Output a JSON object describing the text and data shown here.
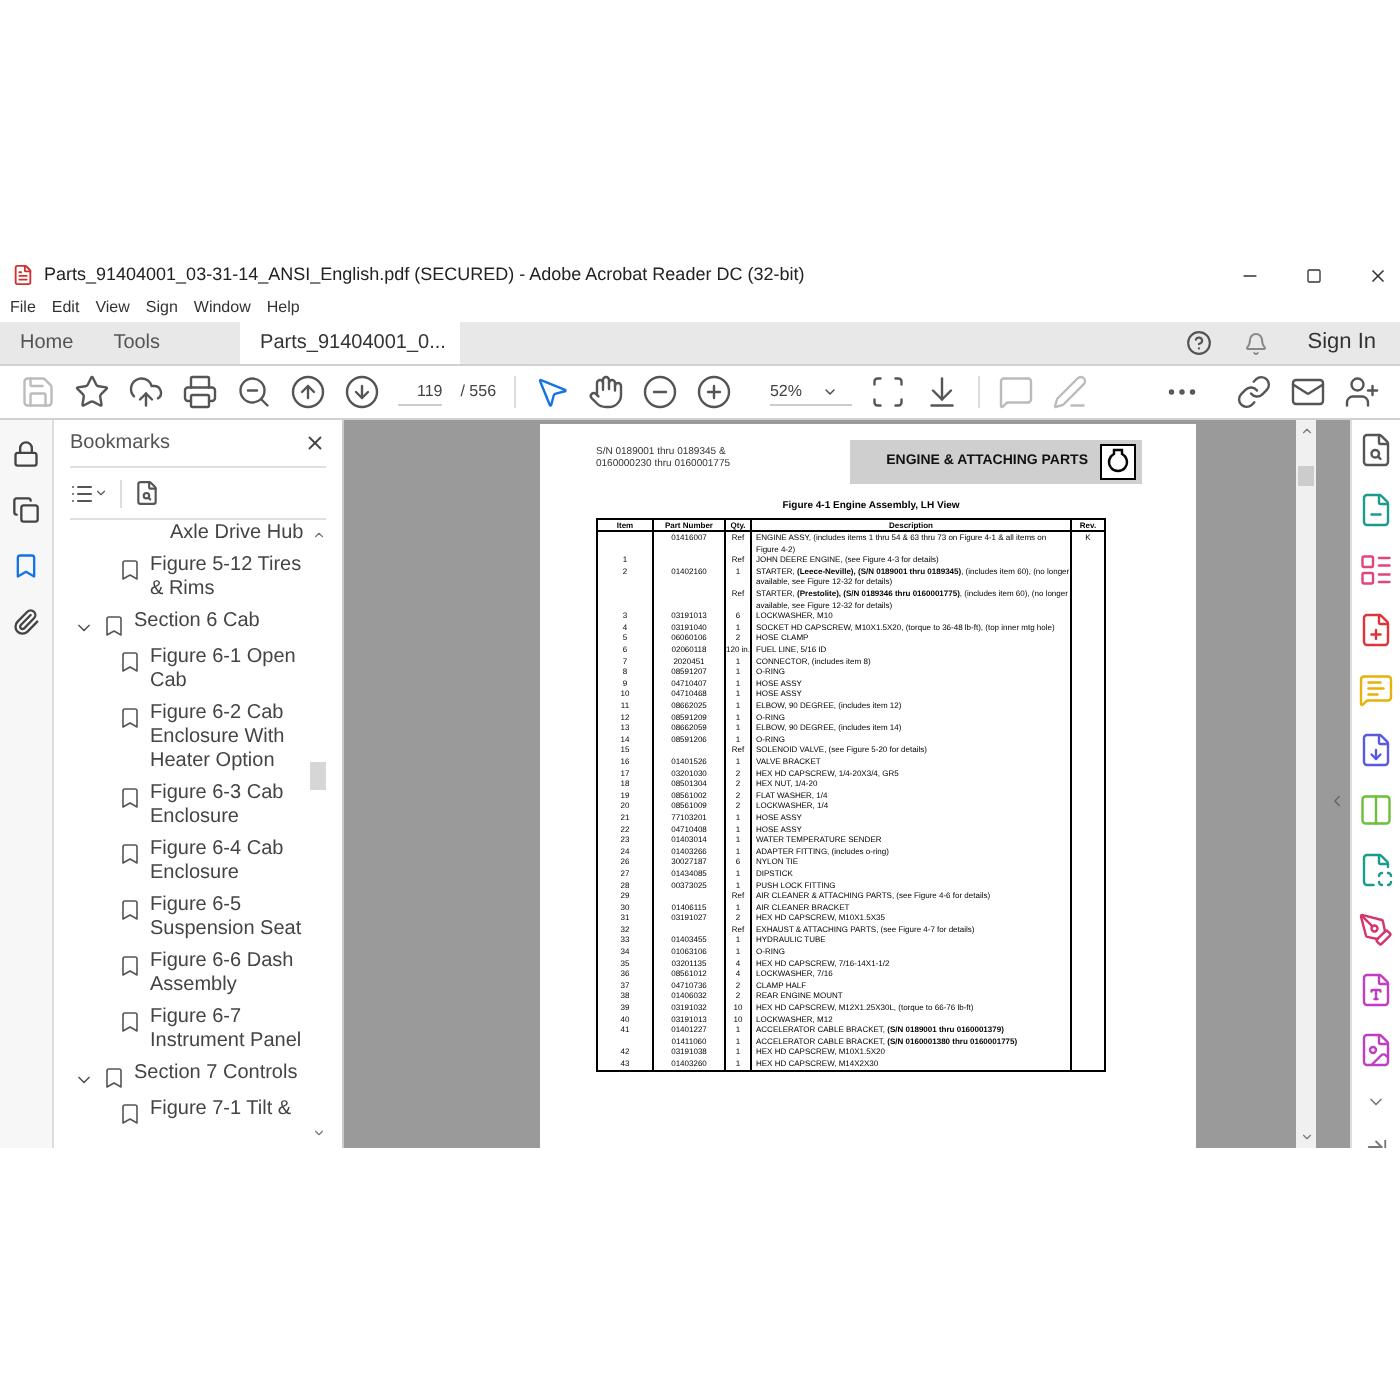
{
  "window": {
    "title": "Parts_91404001_03-31-14_ANSI_English.pdf (SECURED) - Adobe Acrobat Reader DC (32-bit)"
  },
  "menu": [
    "File",
    "Edit",
    "View",
    "Sign",
    "Window",
    "Help"
  ],
  "tabs": [
    {
      "label": "Home",
      "selected": false
    },
    {
      "label": "Tools",
      "selected": false
    },
    {
      "label": "Parts_91404001_0...",
      "selected": true
    }
  ],
  "sign_in": "Sign In",
  "toolbar": {
    "page": "119",
    "page_count": "/ 556",
    "zoom": "52%"
  },
  "bookmarks": {
    "title": "Bookmarks",
    "continued": [
      {
        "label": "Axle Drive Hub"
      },
      {
        "label": "Figure 5-12 Tires & Rims"
      }
    ],
    "sections": [
      {
        "label": "Section 6 Cab",
        "expanded": true,
        "children": [
          {
            "label": "Figure 6-1 Open Cab"
          },
          {
            "label": "Figure 6-2 Cab Enclosure With Heater Option"
          },
          {
            "label": "Figure 6-3 Cab Enclosure"
          },
          {
            "label": "Figure 6-4 Cab Enclosure"
          },
          {
            "label": "Figure 6-5 Suspension Seat"
          },
          {
            "label": "Figure 6-6 Dash Assembly"
          },
          {
            "label": "Figure 6-7 Instrument Panel"
          }
        ]
      },
      {
        "label": "Section 7 Controls",
        "expanded": true,
        "children": [
          {
            "label": "Figure 7-1 Tilt &"
          }
        ]
      }
    ]
  },
  "document": {
    "serial_lines": [
      "S/N 0189001 thru 0189345 &",
      "0160000230 thru 0160001775"
    ],
    "section_title": "ENGINE & ATTACHING PARTS",
    "figure_title": "Figure 4-1 Engine Assembly, LH View",
    "columns": [
      "Item",
      "Part Number",
      "Qty.",
      "Description",
      "Rev."
    ],
    "rows": [
      [
        "",
        "01416007",
        "Ref",
        "ENGINE ASSY, (includes items 1 thru 54 & 63 thru 73 on Figure 4-1 & all items on Figure 4-2)",
        "K"
      ],
      [
        "1",
        "",
        "Ref",
        "JOHN DEERE ENGINE, (see Figure 4-3 for details)",
        ""
      ],
      [
        "2",
        "01402160",
        "1",
        "STARTER, **(Leece-Neville), (S/N 0189001 thru 0189345)**, (includes item 60), (no longer available, see Figure 12-32 for details)",
        ""
      ],
      [
        "",
        "",
        "Ref",
        "STARTER, **(Prestolite), (S/N 0189346 thru 0160001775)**, (includes item 60), (no longer available, see Figure 12-32 for details)",
        ""
      ],
      [
        "3",
        "03191013",
        "6",
        "LOCKWASHER, M10",
        ""
      ],
      [
        "4",
        "03191040",
        "1",
        "SOCKET HD CAPSCREW, M10X1.5X20, (torque to 36-48 lb-ft), (top inner mtg hole)",
        ""
      ],
      [
        "5",
        "06060106",
        "2",
        "HOSE CLAMP",
        ""
      ],
      [
        "6",
        "02060118",
        "120 in.",
        "FUEL LINE, 5/16 ID",
        ""
      ],
      [
        "7",
        "2020451",
        "1",
        "CONNECTOR, (includes item 8)",
        ""
      ],
      [
        "8",
        "08591207",
        "1",
        "O-RING",
        ""
      ],
      [
        "9",
        "04710407",
        "1",
        "HOSE ASSY",
        ""
      ],
      [
        "10",
        "04710468",
        "1",
        "HOSE ASSY",
        ""
      ],
      [
        "11",
        "08662025",
        "1",
        "ELBOW, 90 DEGREE, (includes item 12)",
        ""
      ],
      [
        "12",
        "08591209",
        "1",
        "O-RING",
        ""
      ],
      [
        "13",
        "08662059",
        "1",
        "ELBOW, 90 DEGREE, (includes item 14)",
        ""
      ],
      [
        "14",
        "08591206",
        "1",
        "O-RING",
        ""
      ],
      [
        "15",
        "",
        "Ref",
        "SOLENOID VALVE, (see Figure 5-20 for details)",
        ""
      ],
      [
        "16",
        "01401526",
        "1",
        "VALVE BRACKET",
        ""
      ],
      [
        "17",
        "03201030",
        "2",
        "HEX HD CAPSCREW, 1/4-20X3/4, GR5",
        ""
      ],
      [
        "18",
        "08501304",
        "2",
        "HEX NUT, 1/4-20",
        ""
      ],
      [
        "19",
        "08561002",
        "2",
        "FLAT WASHER, 1/4",
        ""
      ],
      [
        "20",
        "08561009",
        "2",
        "LOCKWASHER, 1/4",
        ""
      ],
      [
        "21",
        "77103201",
        "1",
        "HOSE ASSY",
        ""
      ],
      [
        "22",
        "04710408",
        "1",
        "HOSE ASSY",
        ""
      ],
      [
        "23",
        "01403014",
        "1",
        "WATER TEMPERATURE SENDER",
        ""
      ],
      [
        "24",
        "01403266",
        "1",
        "ADAPTER FITTING, (includes o-ring)",
        ""
      ],
      [
        "26",
        "30027187",
        "6",
        "NYLON TIE",
        ""
      ],
      [
        "27",
        "01434085",
        "1",
        "DIPSTICK",
        ""
      ],
      [
        "28",
        "00373025",
        "1",
        "PUSH LOCK FITTING",
        ""
      ],
      [
        "29",
        "",
        "Ref",
        "AIR CLEANER & ATTACHING PARTS, (see Figure 4-6 for details)",
        ""
      ],
      [
        "30",
        "01406115",
        "1",
        "AIR CLEANER BRACKET",
        ""
      ],
      [
        "31",
        "03191027",
        "2",
        "HEX HD CAPSCREW, M10X1.5X35",
        ""
      ],
      [
        "32",
        "",
        "Ref",
        "EXHAUST & ATTACHING PARTS, (see Figure 4-7 for details)",
        ""
      ],
      [
        "33",
        "01403455",
        "1",
        "HYDRAULIC TUBE",
        ""
      ],
      [
        "34",
        "01063106",
        "1",
        "O-RING",
        ""
      ],
      [
        "35",
        "03201135",
        "4",
        "HEX HD CAPSCREW, 7/16-14X1-1/2",
        ""
      ],
      [
        "36",
        "08561012",
        "4",
        "LOCKWASHER, 7/16",
        ""
      ],
      [
        "37",
        "04710736",
        "2",
        "CLAMP HALF",
        ""
      ],
      [
        "38",
        "01406032",
        "2",
        "REAR ENGINE MOUNT",
        ""
      ],
      [
        "39",
        "03191032",
        "10",
        "HEX HD CAPSCREW, M12X1.25X30L, (torque to 66-76 lb-ft)",
        ""
      ],
      [
        "40",
        "03191013",
        "10",
        "LOCKWASHER, M12",
        ""
      ],
      [
        "41",
        "01401227",
        "1",
        "ACCELERATOR CABLE BRACKET, **(S/N 0189001 thru 0160001379)**",
        ""
      ],
      [
        "",
        "01411060",
        "1",
        "ACCELERATOR CABLE BRACKET, **(S/N 0160001380 thru 0160001775)**",
        ""
      ],
      [
        "42",
        "03191038",
        "1",
        "HEX HD CAPSCREW, M10X1.5X20",
        ""
      ],
      [
        "43",
        "01403260",
        "1",
        "HEX HD CAPSCREW, M14X2X30",
        ""
      ]
    ]
  }
}
